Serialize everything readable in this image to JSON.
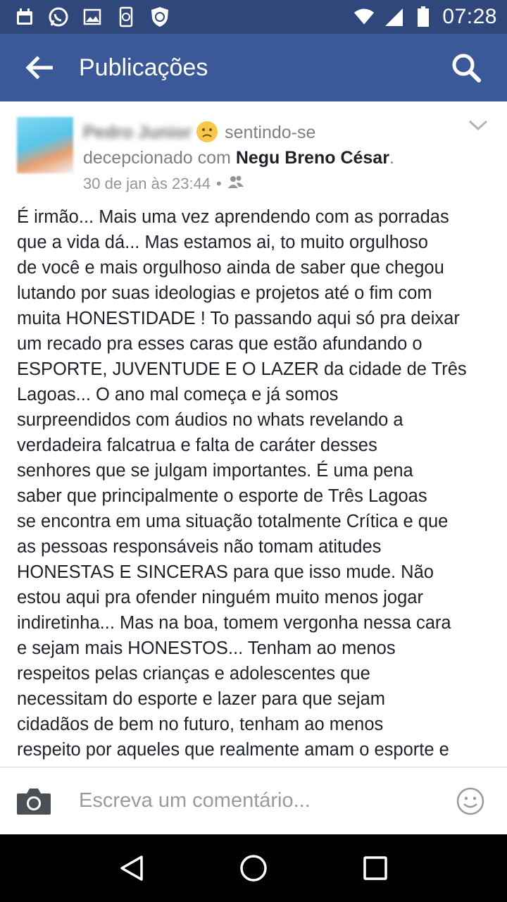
{
  "status_bar": {
    "time": "07:28",
    "left_icons": [
      "calendar-icon",
      "whatsapp-icon",
      "gallery-icon",
      "phone-sync-icon",
      "shield-icon"
    ],
    "right_icons": [
      "wifi-icon",
      "signal-icon",
      "battery-icon"
    ]
  },
  "app_bar": {
    "title": "Publicações",
    "color": "#3b5998"
  },
  "post": {
    "author": "Pedro Junior",
    "feeling_prefix": "sentindo-se",
    "feeling_text": "decepcionado com",
    "tagged": "Negu Breno César",
    "tagged_suffix": ".",
    "timestamp": "30 de jan às 23:44",
    "separator": "•",
    "audience_icon": "friends-icon",
    "body": "É irmão... Mais uma vez aprendendo com as porradas\nque a vida dá... Mas estamos ai, to muito orgulhoso\nde você e mais orgulhoso ainda de saber que chegou\nlutando por suas ideologias e projetos até o fim com\nmuita HONESTIDADE ! To passando aqui só pra deixar\num recado pra esses caras que estão afundando o\nESPORTE, JUVENTUDE E O LAZER da cidade de Três\nLagoas... O ano mal começa e já somos\nsurpreendidos com áudios no whats revelando a\nverdadeira falcatrua e falta de caráter desses\nsenhores que se julgam importantes. É uma pena\nsaber que principalmente o esporte de Três Lagoas\nse encontra em uma situação totalmente Crítica e que\nas pessoas responsáveis não tomam atitudes\nHONESTAS E SINCERAS para que isso mude. Não\nestou aqui pra ofender ninguém muito menos jogar\nindiretinha... Mas na boa, tomem vergonha nessa cara\ne sejam mais HONESTOS... Tenham ao menos\nrespeitos pelas crianças e adolescentes que\nnecessitam do esporte e lazer para que sejam\ncidadãos de bem no futuro, tenham ao menos\nrespeito por aqueles que realmente amam o esporte e"
  },
  "comment_bar": {
    "placeholder": "Escreva um comentário..."
  },
  "nav_bar": {
    "buttons": [
      "back-triangle-icon",
      "home-circle-icon",
      "recents-square-icon"
    ]
  }
}
